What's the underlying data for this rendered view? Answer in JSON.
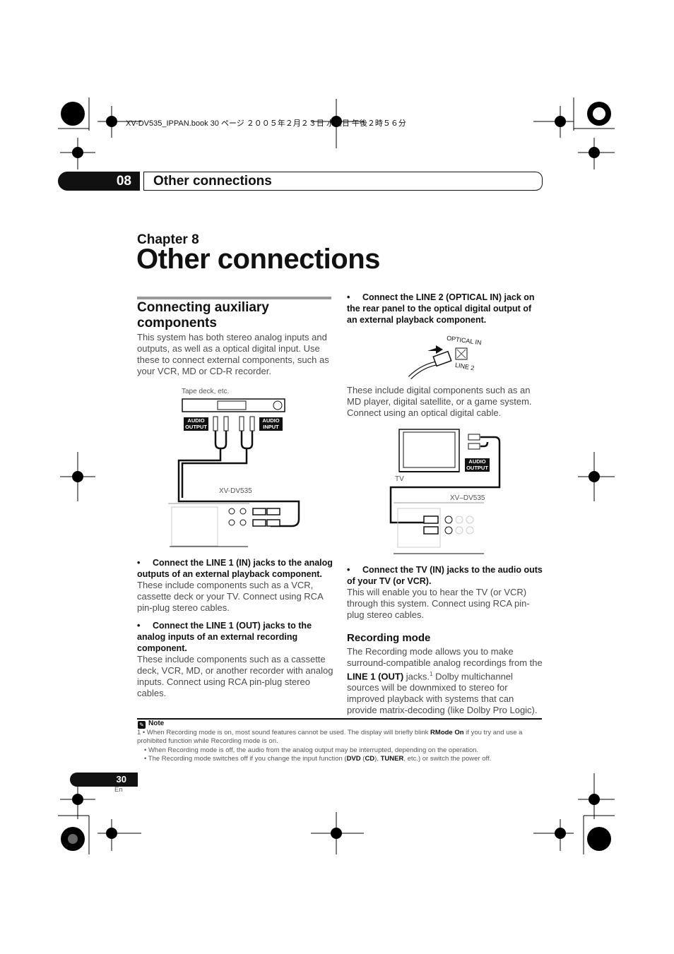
{
  "print_header": "XV-DV535_IPPAN.book  30 ページ  ２００５年２月２３日  水曜日  午後２時５６分",
  "header": {
    "chapter_number": "08",
    "title": "Other connections"
  },
  "chapter_label": "Chapter 8",
  "page_title": "Other connections",
  "left": {
    "heading": "Connecting auxiliary components",
    "intro": "This system has both stereo analog inputs and outputs, as well as a optical digital input. Use these to connect external components, such as your VCR, MD or CD-R recorder.",
    "diagram": {
      "device_label": "Tape deck, etc.",
      "audio_output": "AUDIO OUTPUT",
      "audio_input": "AUDIO INPUT",
      "unit_label": "XV-DV535"
    },
    "bullets": [
      {
        "title": "Connect the LINE 1 (IN) jacks to the analog outputs of an external playback component.",
        "text": "These include components such as a VCR, cassette deck or your TV. Connect using RCA pin-plug stereo cables."
      },
      {
        "title": "Connect the LINE 1 (OUT) jacks to the analog inputs of an external recording component.",
        "text": "These include components such as a cassette deck, VCR, MD, or another recorder with analog inputs. Connect using RCA pin-plug stereo cables."
      }
    ]
  },
  "right": {
    "bullet1": {
      "title": "Connect the LINE 2 (OPTICAL IN) jack on the rear panel to the optical digital output of an external playback component."
    },
    "optical_diagram": {
      "label_top": "OPTICAL IN",
      "label_bottom": "LINE 2"
    },
    "optical_text": "These include digital components such as an MD player, digital satellite, or a game system. Connect using an optical digital cable.",
    "tv_diagram": {
      "tv_label": "TV",
      "audio_output": "AUDIO OUTPUT",
      "unit_label": "XV–DV535"
    },
    "bullet2": {
      "title": "Connect the TV (IN) jacks to the audio outs of your TV (or VCR).",
      "text": "This will enable you to hear the TV (or VCR) through this system. Connect using RCA pin-plug stereo cables."
    },
    "recording": {
      "heading": "Recording mode",
      "text_a": "The Recording mode allows you to make surround-compatible analog recordings from the ",
      "bold": "LINE 1 (OUT)",
      "text_b": " jacks.",
      "sup": "1",
      "text_c": " Dolby multichannel sources will be downmixed to stereo for improved playback with systems that can provide matrix-decoding (like Dolby Pro Logic)."
    }
  },
  "note": {
    "heading": "Note",
    "n1a": "1  • When Recording mode is on, most sound features cannot be used. The display will briefly blink ",
    "n1b": "RMode On",
    "n1c": " if you try and use a prohibited function while Recording mode is on.",
    "n2": "• When Recording mode is off, the audio from the analog output may be interrupted, depending on the operation.",
    "n3a": "• The Recording mode switches off if you change the input function (",
    "n3b": "DVD",
    "n3c": " (",
    "n3d": "CD",
    "n3e": "), ",
    "n3f": "TUNER",
    "n3g": ", etc.) or switch the power off."
  },
  "footer": {
    "page_number": "30",
    "lang": "En"
  }
}
